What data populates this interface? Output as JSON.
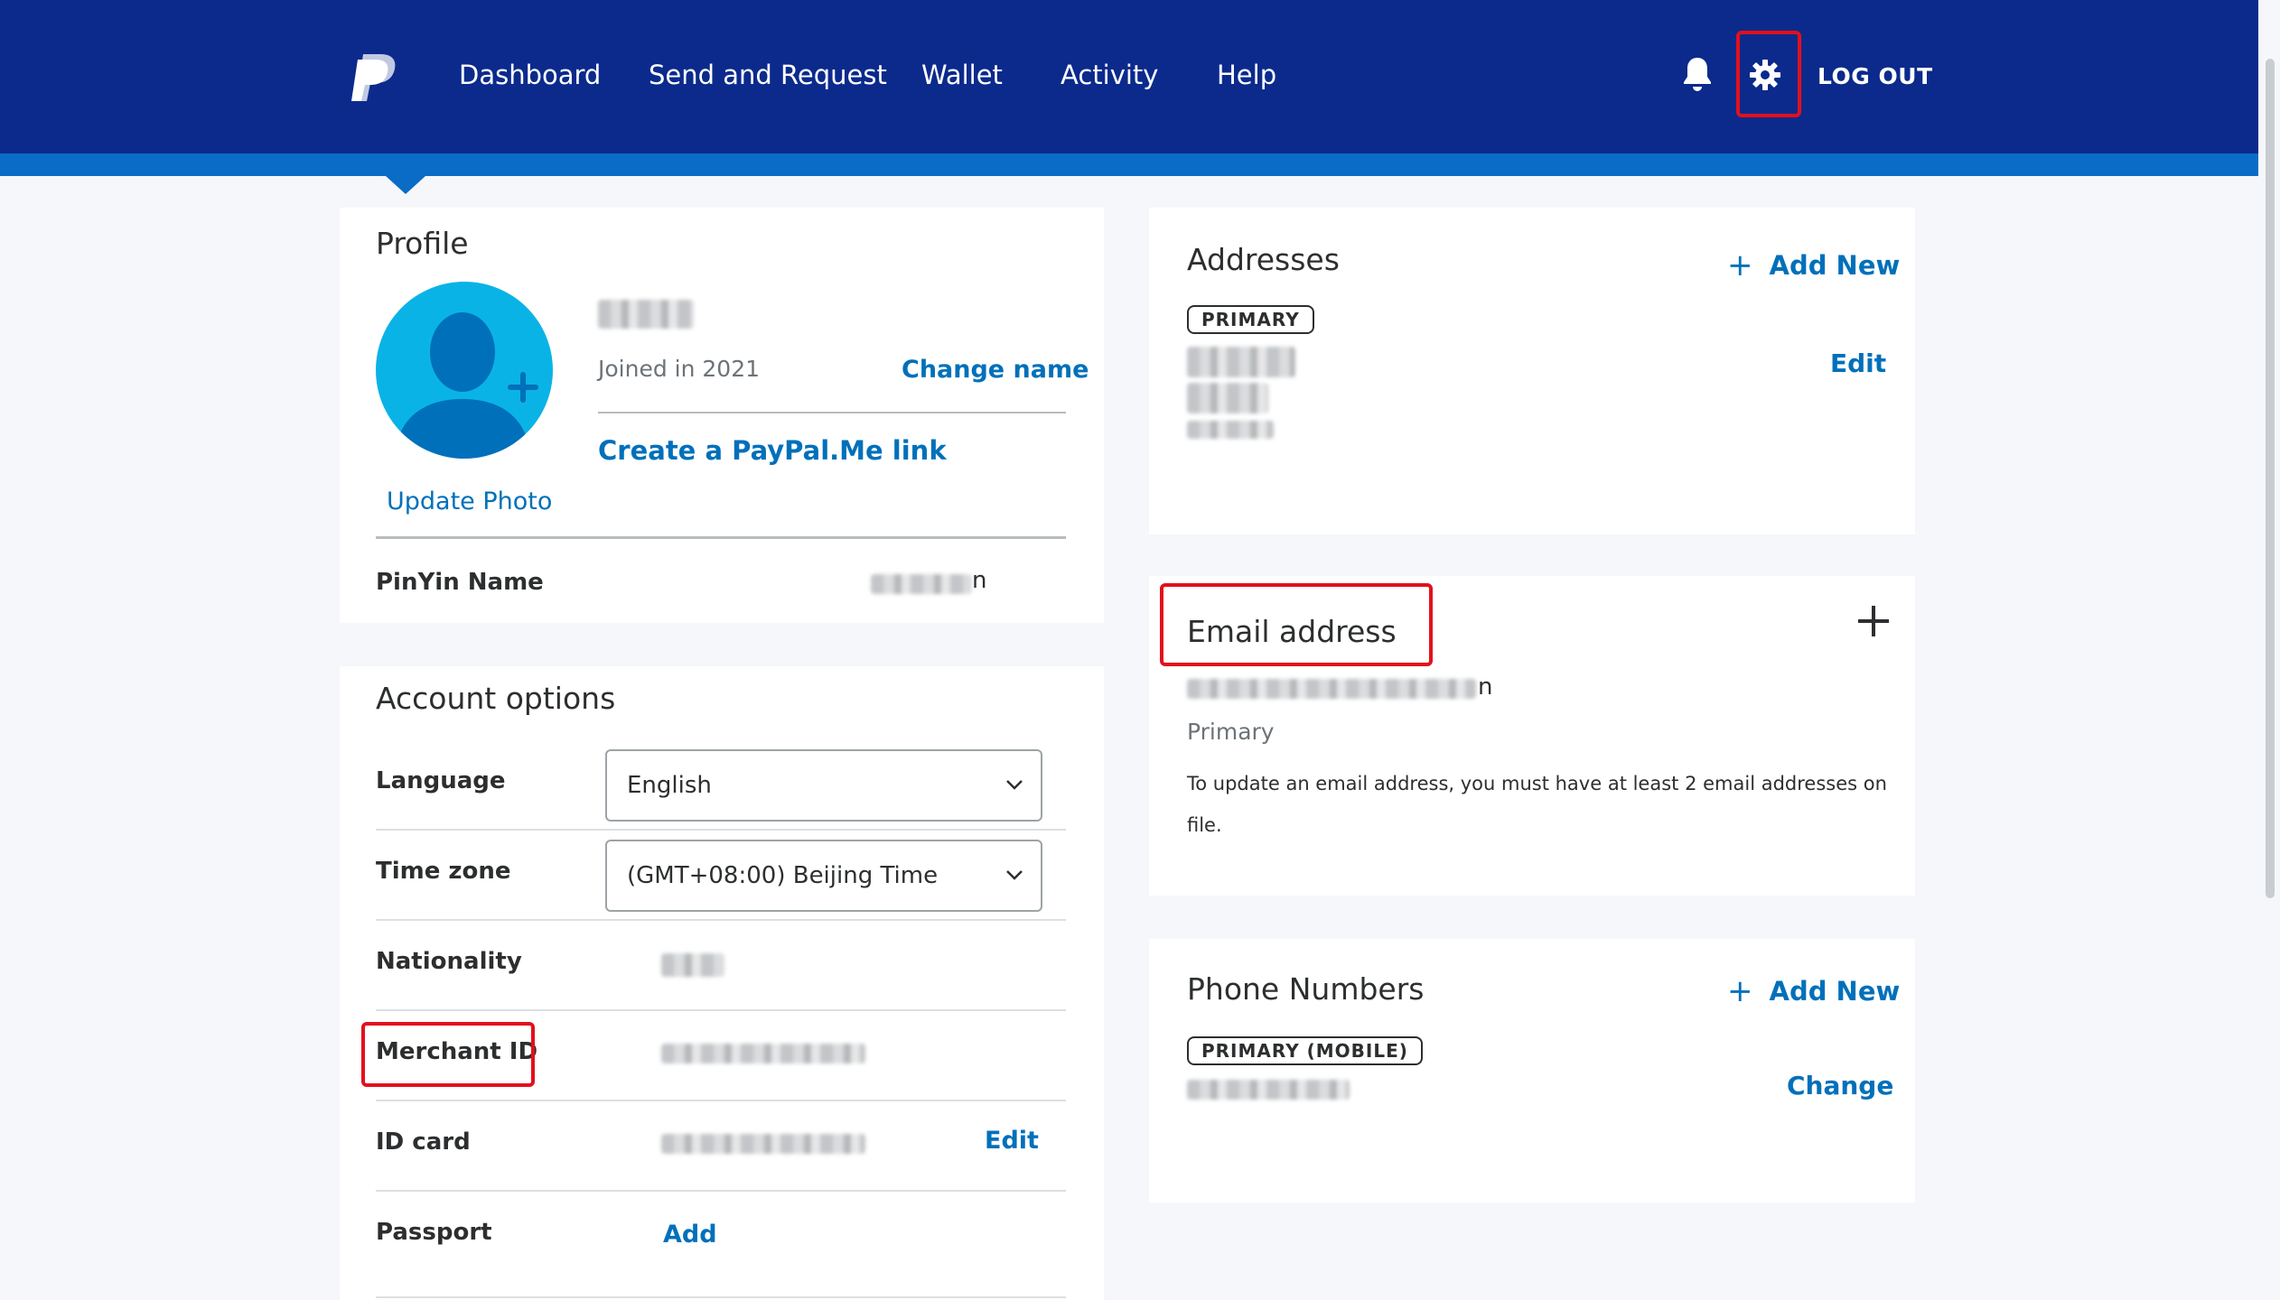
{
  "nav": {
    "items": [
      "Dashboard",
      "Send and Request",
      "Wallet",
      "Activity",
      "Help"
    ],
    "logout": "LOG OUT",
    "bell_icon": "bell-icon",
    "settings_icon": "gear-icon"
  },
  "profile": {
    "title": "Profile",
    "joined": "Joined in 2021",
    "change_name": "Change name",
    "paypal_me": "Create a PayPal.Me link",
    "update_photo": "Update Photo",
    "pinyin_label": "PinYin Name",
    "pinyin_suffix": "n"
  },
  "account": {
    "title": "Account options",
    "language_label": "Language",
    "language_value": "English",
    "timezone_label": "Time zone",
    "timezone_value": "(GMT+08:00) Beijing Time",
    "nationality_label": "Nationality",
    "merchant_label": "Merchant ID",
    "idcard_label": "ID card",
    "idcard_action": "Edit",
    "passport_label": "Passport",
    "passport_action": "Add"
  },
  "addresses": {
    "title": "Addresses",
    "add_new": "Add New",
    "badge": "PRIMARY",
    "edit": "Edit"
  },
  "email": {
    "title": "Email address",
    "email_suffix": "n",
    "primary": "Primary",
    "note_line1": "To update an email address, you must have at least 2 email addresses on",
    "note_line2": "file."
  },
  "phone": {
    "title": "Phone Numbers",
    "add_new": "Add New",
    "badge": "PRIMARY (MOBILE)",
    "change": "Change"
  },
  "colors": {
    "header": "#0b2a8c",
    "stripe": "#0a6cc6",
    "link": "#0070ba",
    "highlight": "#e3101c"
  }
}
